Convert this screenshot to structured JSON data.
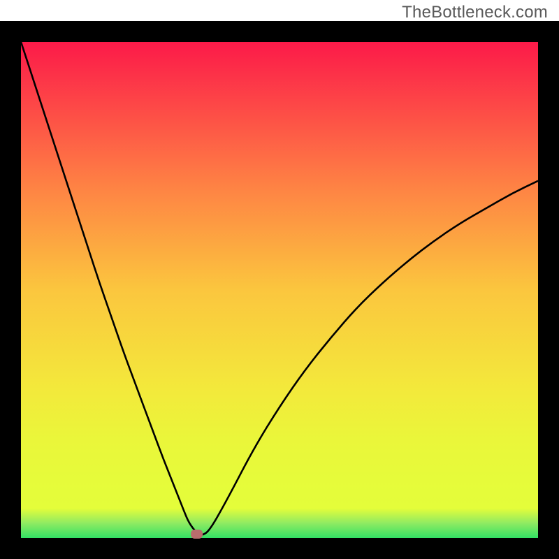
{
  "watermark": "TheBottleneck.com",
  "colors": {
    "frame_stroke": "#000000",
    "bg": "#ffffff",
    "curve_stroke": "#000000",
    "marker_fill": "#b96d6d",
    "marker_stroke": "#b96d6d",
    "gradient_stops": [
      {
        "offset": 0.0,
        "color": "#fc1a49"
      },
      {
        "offset": 0.3,
        "color": "#fe8544"
      },
      {
        "offset": 0.5,
        "color": "#fbc63e"
      },
      {
        "offset": 0.7,
        "color": "#f3e93b"
      },
      {
        "offset": 0.8,
        "color": "#eaf63a"
      },
      {
        "offset": 0.88,
        "color": "#e6fb3a"
      },
      {
        "offset": 0.94,
        "color": "#e4fd3a"
      },
      {
        "offset": 0.97,
        "color": "#8feb62"
      },
      {
        "offset": 1.0,
        "color": "#32e164"
      }
    ]
  },
  "chart_data": {
    "type": "line",
    "title": "",
    "xlabel": "",
    "ylabel": "",
    "xlim": [
      0,
      100
    ],
    "ylim": [
      0,
      100
    ],
    "grid": false,
    "legend": false,
    "series": [
      {
        "name": "bottleneck-curve",
        "x": [
          0,
          2.5,
          5,
          7.5,
          10,
          12.5,
          15,
          17.5,
          20,
          22.5,
          25,
          27.5,
          30,
          31.5,
          32.5,
          34,
          35,
          36.5,
          40,
          45,
          50,
          55,
          60,
          65,
          70,
          75,
          80,
          85,
          90,
          95,
          100
        ],
        "y": [
          100,
          92,
          84,
          76,
          68,
          60,
          52,
          44.5,
          37,
          30,
          23,
          16,
          9.5,
          5.5,
          3,
          1,
          0.5,
          1.5,
          8,
          18,
          26.5,
          34,
          40.5,
          46.5,
          51.5,
          56,
          60,
          63.5,
          66.5,
          69.5,
          72
        ]
      }
    ],
    "marker": {
      "x": 34,
      "y": 0.8,
      "shape": "rounded-rect"
    },
    "notes": "x and y are in percent of the plot area (0–100). Values estimated from pixels."
  }
}
